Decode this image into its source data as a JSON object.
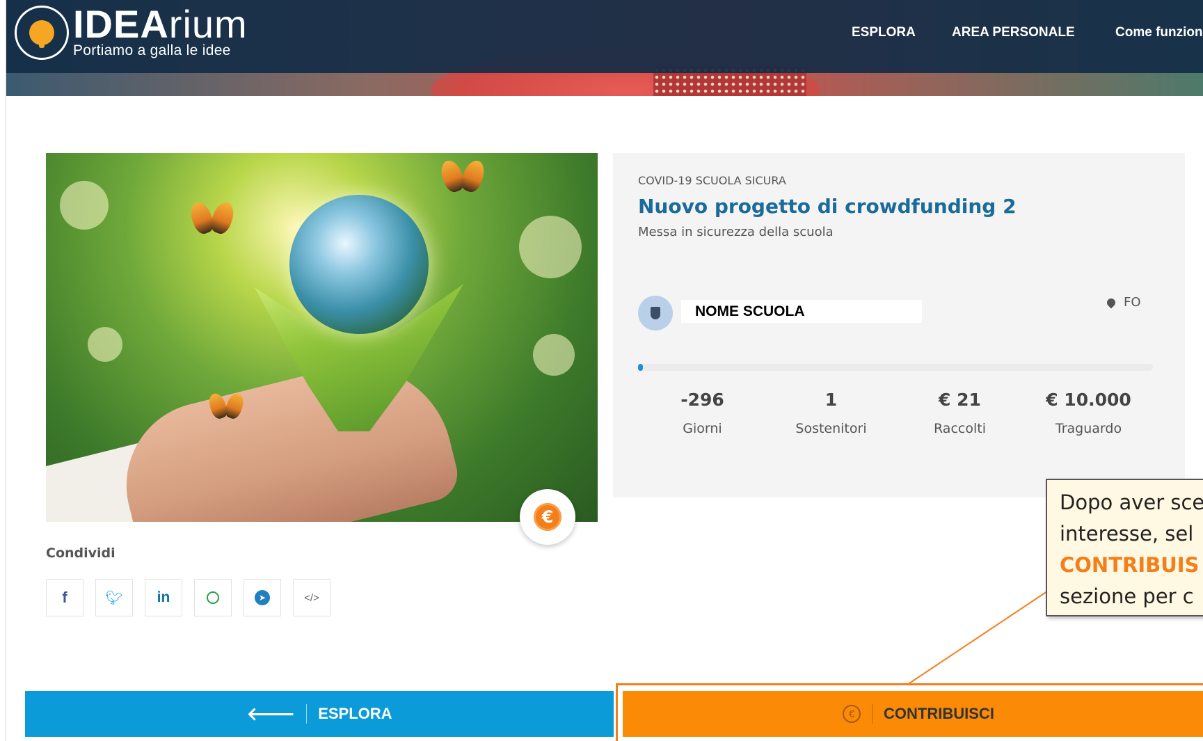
{
  "header": {
    "logo_name_bold": "IDEA",
    "logo_name_rest": "rium",
    "logo_tagline": "Portiamo a galla le idee",
    "nav": [
      {
        "label": "ESPLORA"
      },
      {
        "label": "AREA PERSONALE"
      },
      {
        "label": "Come funziona"
      }
    ]
  },
  "project": {
    "category": "COVID-19 SCUOLA SICURA",
    "title": "Nuovo progetto di crowdfunding 2",
    "subtitle": "Messa in sicurezza della scuola",
    "school_name": "NOME SCUOLA",
    "location": "FO",
    "progress_fraction": 0.002,
    "stats": [
      {
        "value": "-296",
        "label": "Giorni"
      },
      {
        "value": "1",
        "label": "Sostenitori"
      },
      {
        "value": "€ 21",
        "label": "Raccolti"
      },
      {
        "value": "€ 10.000",
        "label": "Traguardo"
      }
    ]
  },
  "share": {
    "label": "Condividi",
    "icons": [
      "facebook-icon",
      "twitter-icon",
      "linkedin-icon",
      "whatsapp-icon",
      "telegram-icon",
      "embed-icon"
    ]
  },
  "tooltip": {
    "line1": "Dopo aver sce",
    "line2": "interesse, sel",
    "line3_highlight": "CONTRIBUIS",
    "line4": "sezione per c"
  },
  "actions": {
    "explore_label": "ESPLORA",
    "contribute_label": "CONTRIBUISCI"
  },
  "colors": {
    "navbar": "#14304a",
    "title_blue": "#1a6b9a",
    "explore_button": "#0b9bd8",
    "contribute_button": "#fb8a07",
    "highlight_orange": "#f47f1a"
  }
}
